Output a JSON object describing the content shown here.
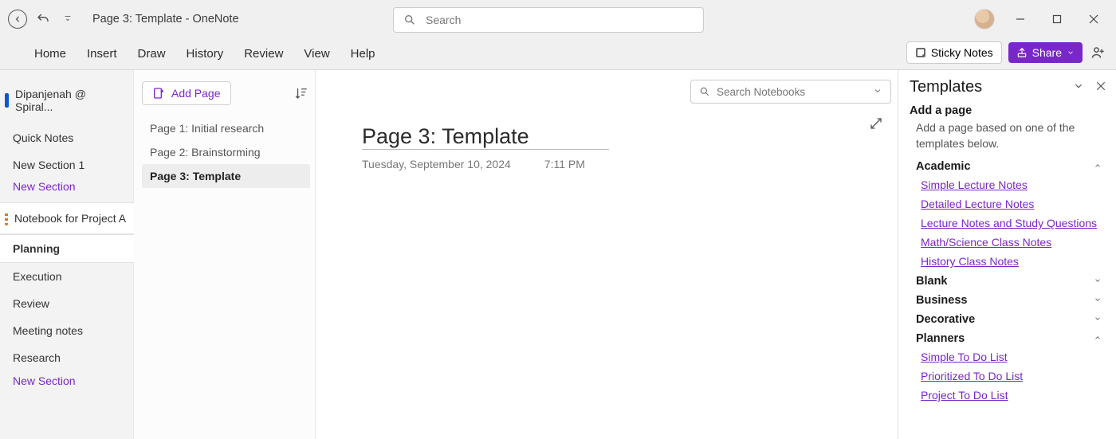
{
  "app": {
    "title": "Page 3: Template  -  OneNote",
    "search_placeholder": "Search",
    "sticky_notes_label": "Sticky Notes",
    "share_label": "Share"
  },
  "ribbon": {
    "tabs": [
      "Home",
      "Insert",
      "Draw",
      "History",
      "Review",
      "View",
      "Help"
    ]
  },
  "sidebar": {
    "notebook_label": "Dipanjenah @ Spiral...",
    "items": [
      {
        "label": "Quick Notes",
        "style": "normal"
      },
      {
        "label": "New Section 1",
        "style": "normal"
      },
      {
        "label": "New Section",
        "style": "purple"
      }
    ],
    "notebook2_label": "Notebook for Project A",
    "sections2": [
      {
        "label": "Planning",
        "active": true
      },
      {
        "label": "Execution"
      },
      {
        "label": "Review"
      },
      {
        "label": "Meeting notes"
      },
      {
        "label": "Research"
      },
      {
        "label": "New Section",
        "style": "purple"
      }
    ]
  },
  "pagelist": {
    "add_page_label": "Add Page",
    "pages": [
      {
        "label": "Page 1: Initial research"
      },
      {
        "label": "Page 2: Brainstorming"
      },
      {
        "label": "Page 3: Template",
        "active": true
      }
    ]
  },
  "canvas": {
    "notebook_search_placeholder": "Search Notebooks",
    "page_title": "Page 3: Template",
    "page_date": "Tuesday, September 10, 2024",
    "page_time": "7:11 PM"
  },
  "templates": {
    "title": "Templates",
    "subtitle": "Add a page",
    "description": "Add a page based on one of the templates below.",
    "categories": [
      {
        "name": "Academic",
        "expanded": true,
        "links": [
          "Simple Lecture Notes",
          "Detailed Lecture Notes",
          "Lecture Notes and Study Questions",
          "Math/Science Class Notes",
          "History Class Notes"
        ]
      },
      {
        "name": "Blank",
        "expanded": false
      },
      {
        "name": "Business",
        "expanded": false
      },
      {
        "name": "Decorative",
        "expanded": false
      },
      {
        "name": "Planners",
        "expanded": true,
        "links": [
          "Simple To Do List",
          "Prioritized To Do List",
          "Project To Do List"
        ]
      }
    ]
  }
}
